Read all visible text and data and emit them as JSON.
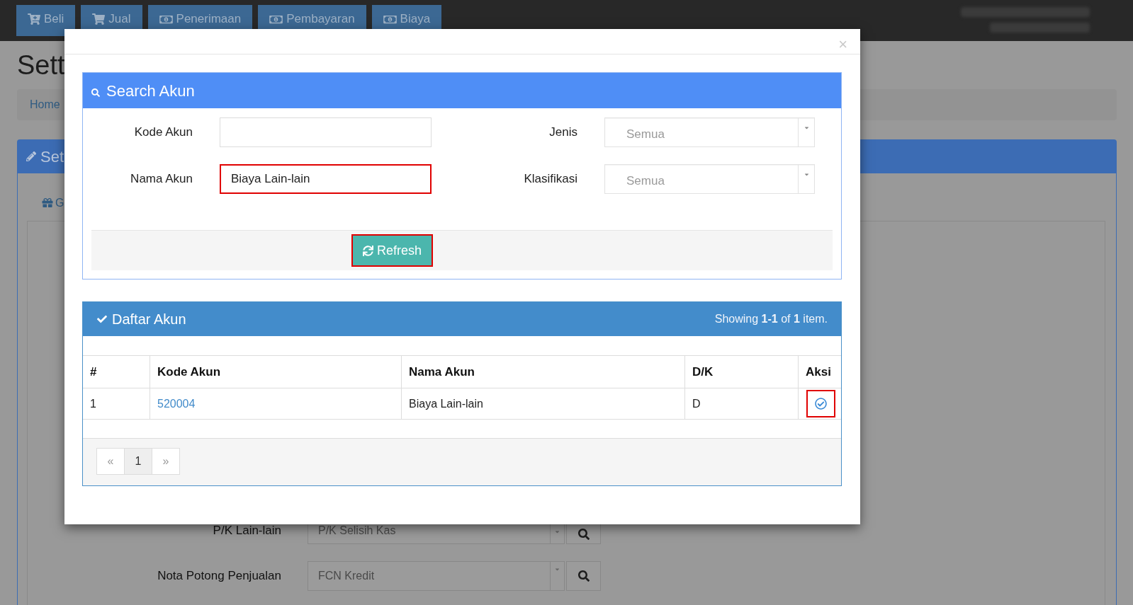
{
  "navbar": {
    "tabs": [
      {
        "label": "Beli",
        "kind": "purchase"
      },
      {
        "label": "Jual",
        "kind": "sale"
      },
      {
        "label": "Penerimaan",
        "kind": "money"
      },
      {
        "label": "Pembayaran",
        "kind": "money"
      },
      {
        "label": "Biaya",
        "kind": "money"
      }
    ]
  },
  "page": {
    "heading": "Sett",
    "breadcrumb": [
      "Home"
    ],
    "panel": {
      "title": "Set",
      "tab": "G",
      "form_rows": [
        {
          "label": "P/K Lain-lain",
          "value": "P/K Selisih Kas"
        },
        {
          "label": "Nota Potong Penjualan",
          "value": "FCN Kredit"
        }
      ]
    }
  },
  "modal": {
    "close": "×",
    "search_panel": {
      "title": "Search Akun",
      "fields": [
        {
          "label": "Kode Akun",
          "kind": "text",
          "highlighted": false
        },
        {
          "label": "Jenis",
          "kind": "select",
          "placeholder": "Semua"
        },
        {
          "label": "Nama Akun",
          "kind": "text",
          "value": "Biaya Lain-lain",
          "highlighted": true
        },
        {
          "label": "Klasifikasi",
          "kind": "select",
          "placeholder": "Semua"
        }
      ],
      "refresh_button": {
        "label": "Refresh",
        "highlighted": true
      }
    },
    "list_panel": {
      "title": "Daftar Akun",
      "summary": "Showing **1-1** of **1** item.",
      "table": {
        "columns": [
          "#",
          "Kode Akun",
          "Nama Akun",
          "D/K",
          "Aksi"
        ],
        "rows": [
          {
            "number": "1",
            "code": "520004",
            "name": "Biaya Lain-lain",
            "dk": "D",
            "action_highlighted": true
          }
        ]
      },
      "pagination": [
        {
          "label": "«",
          "selected": false,
          "disabled": true
        },
        {
          "label": "1",
          "selected": true,
          "disabled": false
        },
        {
          "label": "»",
          "selected": false,
          "disabled": true
        }
      ]
    }
  }
}
